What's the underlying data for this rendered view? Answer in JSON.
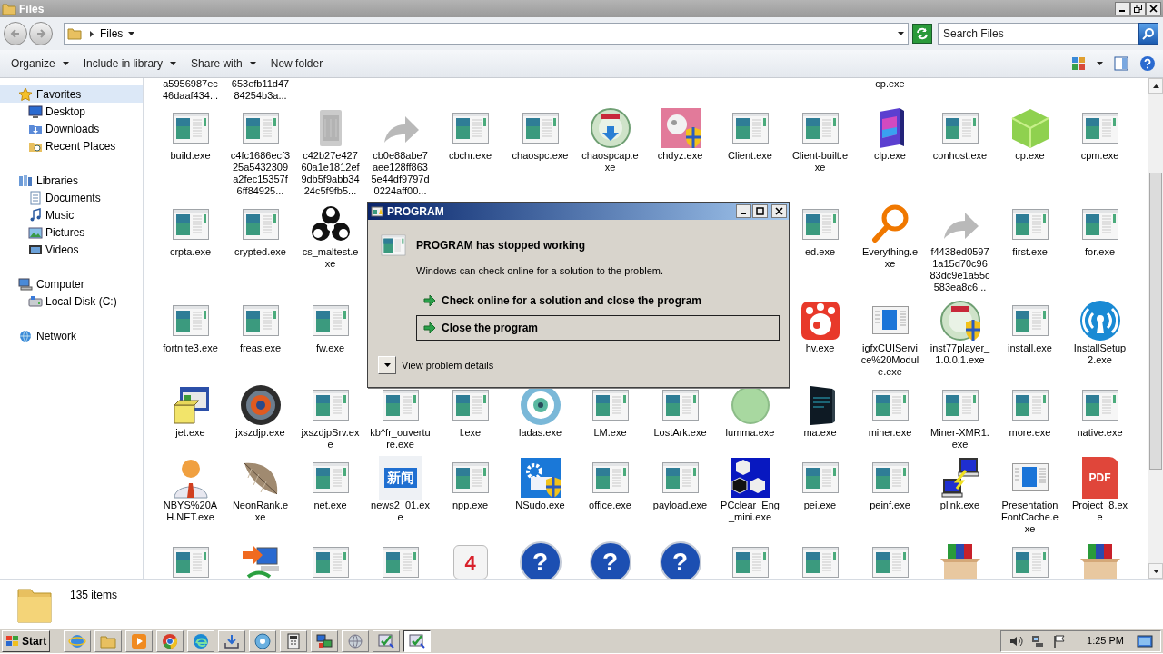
{
  "window": {
    "title": "Files"
  },
  "address_bar": {
    "breadcrumb": "Files",
    "search": {
      "placeholder": "Search Files"
    }
  },
  "toolbar": {
    "buttons": [
      {
        "label": "Organize",
        "dropdown": true
      },
      {
        "label": "Include in library",
        "dropdown": true
      },
      {
        "label": "Share with",
        "dropdown": true
      },
      {
        "label": "New folder",
        "dropdown": false
      }
    ]
  },
  "sidebar": {
    "items": [
      {
        "label": "Favorites",
        "kind": "favorites",
        "selected": true,
        "children": [
          {
            "label": "Desktop",
            "kind": "desktop",
            "selected": false
          },
          {
            "label": "Downloads",
            "kind": "downloads",
            "selected": false
          },
          {
            "label": "Recent Places",
            "kind": "recent",
            "selected": false
          }
        ]
      },
      {
        "label": "Libraries",
        "kind": "libraries",
        "selected": false,
        "children": [
          {
            "label": "Documents",
            "kind": "documents",
            "selected": false
          },
          {
            "label": "Music",
            "kind": "music",
            "selected": false
          },
          {
            "label": "Pictures",
            "kind": "pictures",
            "selected": false
          },
          {
            "label": "Videos",
            "kind": "videos",
            "selected": false
          }
        ]
      },
      {
        "label": "Computer",
        "kind": "computer",
        "selected": false,
        "children": [
          {
            "label": "Local Disk (C:)",
            "kind": "disk",
            "selected": false
          }
        ]
      },
      {
        "label": "Network",
        "kind": "network",
        "selected": false
      }
    ]
  },
  "files": {
    "rows": [
      {
        "groups": [
          [
            {
              "kind": "clipped",
              "label": "a5956987ec46daaf434..."
            },
            {
              "kind": "clipped",
              "label": "653efb11d4784254b3a..."
            }
          ],
          [
            {
              "kind": "clipped",
              "label": "cp.exe"
            }
          ]
        ]
      },
      {
        "groups": [
          [
            {
              "kind": "app",
              "label": "build.exe"
            },
            {
              "kind": "app",
              "label": "c4fc1686ecf325a5432309a2fec15357f6ff84925..."
            },
            {
              "kind": "bin",
              "label": "c42b27e42760a1e1812ef9db5f9abb3424c5f9fb5..."
            },
            {
              "kind": "arrow",
              "label": "cb0e88abe7aee128ff8635e44df9797d0224aff00..."
            },
            {
              "kind": "app",
              "label": "cbchr.exe"
            },
            {
              "kind": "app",
              "label": "chaospc.exe"
            },
            {
              "kind": "disc",
              "label": "chaospcap.exe"
            },
            {
              "kind": "pink_shield",
              "label": "chdyz.exe"
            },
            {
              "kind": "app",
              "label": "Client.exe"
            },
            {
              "kind": "app",
              "label": "Client-built.exe"
            },
            {
              "kind": "purple_box",
              "label": "clp.exe"
            },
            {
              "kind": "app",
              "label": "conhost.exe"
            },
            {
              "kind": "cube",
              "label": "cp.exe"
            },
            {
              "kind": "app",
              "label": "cpm.exe"
            }
          ]
        ]
      },
      {
        "groups": [
          [
            {
              "kind": "app",
              "label": "crpta.exe"
            },
            {
              "kind": "app",
              "label": "crypted.exe"
            },
            {
              "kind": "biohazard",
              "label": "cs_maltest.exe"
            }
          ],
          [
            {
              "kind": "app",
              "label": "ed.exe"
            },
            {
              "kind": "magnifier",
              "label": "Everything.exe"
            },
            {
              "kind": "arrow",
              "label": "f4438ed05971a15d70c9683dc9e1a55c583ea8c6..."
            },
            {
              "kind": "app",
              "label": "first.exe"
            },
            {
              "kind": "app",
              "label": "for.exe"
            }
          ]
        ]
      },
      {
        "groups": [
          [
            {
              "kind": "app",
              "label": "fortnite3.exe"
            },
            {
              "kind": "app",
              "label": "freas.exe"
            },
            {
              "kind": "app",
              "label": "fw.exe"
            }
          ],
          [
            {
              "kind": "red_tile",
              "label": "hv.exe"
            },
            {
              "kind": "window",
              "label": "igfxCUIService%20Module.exe"
            },
            {
              "kind": "disc_shield",
              "label": "inst77player_1.0.0.1.exe"
            },
            {
              "kind": "app",
              "label": "install.exe"
            },
            {
              "kind": "wireless",
              "label": "InstallSetup2.exe"
            }
          ]
        ]
      },
      {
        "groups": [
          [
            {
              "kind": "setup_box",
              "label": "jet.exe"
            },
            {
              "kind": "gear_disc",
              "label": "jxszdjp.exe"
            },
            {
              "kind": "app",
              "label": "jxszdjpSrv.exe"
            },
            {
              "kind": "app",
              "label": "kb^fr_ouverture.exe"
            },
            {
              "kind": "app",
              "label": "l.exe"
            },
            {
              "kind": "eye",
              "label": "ladas.exe"
            },
            {
              "kind": "app",
              "label": "LM.exe"
            },
            {
              "kind": "app",
              "label": "LostArk.exe"
            },
            {
              "kind": "circle",
              "label": "lumma.exe"
            },
            {
              "kind": "dark_box",
              "label": "ma.exe"
            },
            {
              "kind": "app",
              "label": "miner.exe"
            },
            {
              "kind": "app",
              "label": "Miner-XMR1.exe"
            },
            {
              "kind": "app",
              "label": "more.exe"
            },
            {
              "kind": "app",
              "label": "native.exe"
            }
          ]
        ]
      },
      {
        "groups": [
          [
            {
              "kind": "person",
              "label": "NBYS%20AH.NET.exe"
            },
            {
              "kind": "feather",
              "label": "NeonRank.exe"
            },
            {
              "kind": "app",
              "label": "net.exe"
            },
            {
              "kind": "news",
              "label": "news2_01.exe",
              "icon_text": "新闻"
            },
            {
              "kind": "app",
              "label": "npp.exe"
            },
            {
              "kind": "gear_shield",
              "label": "NSudo.exe"
            },
            {
              "kind": "app",
              "label": "office.exe"
            },
            {
              "kind": "app",
              "label": "payload.exe"
            },
            {
              "kind": "cubes",
              "label": "PCclear_Eng_mini.exe"
            },
            {
              "kind": "app",
              "label": "pei.exe"
            },
            {
              "kind": "app",
              "label": "peinf.exe"
            },
            {
              "kind": "computers",
              "label": "plink.exe"
            },
            {
              "kind": "window",
              "label": "PresentationFontCache.exe"
            },
            {
              "kind": "pdf",
              "label": "Project_8.exe",
              "icon_text": "PDF"
            }
          ]
        ]
      },
      {
        "groups": [
          [
            {
              "kind": "app"
            },
            {
              "kind": "network"
            },
            {
              "kind": "app"
            },
            {
              "kind": "app"
            },
            {
              "kind": "dice",
              "icon_text": "4"
            },
            {
              "kind": "help",
              "icon_text": "?"
            },
            {
              "kind": "help",
              "icon_text": "?"
            },
            {
              "kind": "help",
              "icon_text": "?"
            },
            {
              "kind": "app"
            },
            {
              "kind": "app"
            },
            {
              "kind": "app"
            },
            {
              "kind": "books_box"
            },
            {
              "kind": "app"
            },
            {
              "kind": "books_box"
            }
          ]
        ]
      }
    ]
  },
  "dialog": {
    "title": "PROGRAM",
    "heading": "PROGRAM has stopped working",
    "message": "Windows can check online for a solution to the problem.",
    "options": [
      {
        "label": "Check online for a solution and close the program",
        "focused": false
      },
      {
        "label": "Close the program",
        "focused": true
      }
    ],
    "details": "View problem details"
  },
  "status_bar": {
    "count": "135 items"
  },
  "taskbar": {
    "start": "Start",
    "items": [
      {
        "kind": "ie",
        "selected": false
      },
      {
        "kind": "explorer",
        "selected": false
      },
      {
        "kind": "media",
        "selected": false
      },
      {
        "kind": "chrome",
        "selected": false
      },
      {
        "kind": "edge",
        "selected": false
      },
      {
        "kind": "download",
        "selected": false
      },
      {
        "kind": "disc",
        "selected": false
      },
      {
        "kind": "calc",
        "selected": false
      },
      {
        "kind": "network",
        "selected": false
      },
      {
        "kind": "globe",
        "selected": false
      },
      {
        "kind": "check",
        "selected": false
      },
      {
        "kind": "check",
        "selected": true
      }
    ],
    "clock": "1:25 PM"
  }
}
